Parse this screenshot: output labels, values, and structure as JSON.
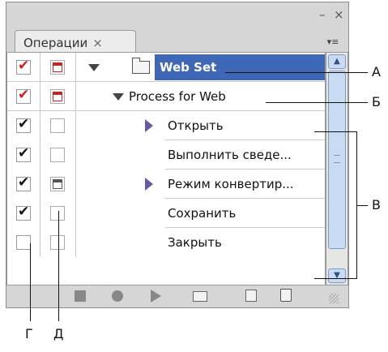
{
  "panel": {
    "tab_label": "Операции",
    "tab_close": "×",
    "minimize": "–",
    "close": "×",
    "menu": "▾≡"
  },
  "rows": [
    {
      "label": "Web Set",
      "type": "set",
      "enabled": "✔",
      "dialog": "on"
    },
    {
      "label": "Process for Web",
      "type": "action",
      "enabled": "✔",
      "dialog": "on"
    },
    {
      "label": "Открыть",
      "type": "step-expandable",
      "enabled": "✔",
      "dialog": "off"
    },
    {
      "label": "Выполнить сведе...",
      "type": "step",
      "enabled": "✔",
      "dialog": "off"
    },
    {
      "label": "Режим конвертир...",
      "type": "step-expandable",
      "enabled": "✔",
      "dialog": "gray"
    },
    {
      "label": "Сохранить",
      "type": "step",
      "enabled": "✔",
      "dialog": "off"
    },
    {
      "label": "Закрыть",
      "type": "step",
      "enabled": "",
      "dialog": "off"
    }
  ],
  "toolbar": {
    "icons": [
      "stop-icon",
      "record-icon",
      "play-icon",
      "new-set-icon",
      "new-action-icon",
      "delete-icon",
      "resize-grip-icon"
    ]
  },
  "annotations": {
    "a": "А",
    "b": "Б",
    "v": "В",
    "g": "Г",
    "d": "Д"
  },
  "colors": {
    "selection": "#3f67b8",
    "enabled_check": "#cc2222",
    "scrollbar": "#c9dbf3"
  }
}
